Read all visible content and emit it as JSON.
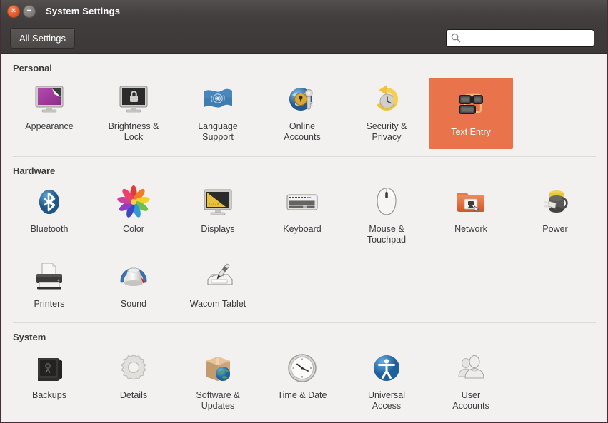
{
  "window": {
    "title": "System Settings",
    "close_label": "×",
    "minimize_label": "−"
  },
  "toolbar": {
    "all_settings_label": "All Settings",
    "search_placeholder": "",
    "search_value": "",
    "search_icon": "search-icon"
  },
  "colors": {
    "selection": "#e9744c",
    "titlebar": "#464342",
    "content_bg": "#f2f1f0",
    "label_text": "#3b3b3b",
    "section_text": "#3c3b37"
  },
  "sections": [
    {
      "title": "Personal",
      "rows": [
        [
          {
            "label": "Appearance",
            "icon": "appearance-icon",
            "selected": false
          },
          {
            "label": "Brightness &\nLock",
            "icon": "brightness-lock-icon",
            "selected": false
          },
          {
            "label": "Language\nSupport",
            "icon": "language-support-icon",
            "selected": false
          },
          {
            "label": "Online\nAccounts",
            "icon": "online-accounts-icon",
            "selected": false
          },
          {
            "label": "Security &\nPrivacy",
            "icon": "security-privacy-icon",
            "selected": false
          },
          {
            "label": "Text Entry",
            "icon": "text-entry-icon",
            "selected": true
          }
        ]
      ]
    },
    {
      "title": "Hardware",
      "rows": [
        [
          {
            "label": "Bluetooth",
            "icon": "bluetooth-icon",
            "selected": false
          },
          {
            "label": "Color",
            "icon": "color-icon",
            "selected": false
          },
          {
            "label": "Displays",
            "icon": "displays-icon",
            "selected": false
          },
          {
            "label": "Keyboard",
            "icon": "keyboard-icon",
            "selected": false
          },
          {
            "label": "Mouse &\nTouchpad",
            "icon": "mouse-touchpad-icon",
            "selected": false
          },
          {
            "label": "Network",
            "icon": "network-icon",
            "selected": false
          },
          {
            "label": "Power",
            "icon": "power-icon",
            "selected": false
          }
        ],
        [
          {
            "label": "Printers",
            "icon": "printers-icon",
            "selected": false
          },
          {
            "label": "Sound",
            "icon": "sound-icon",
            "selected": false
          },
          {
            "label": "Wacom Tablet",
            "icon": "wacom-tablet-icon",
            "selected": false
          }
        ]
      ]
    },
    {
      "title": "System",
      "rows": [
        [
          {
            "label": "Backups",
            "icon": "backups-icon",
            "selected": false
          },
          {
            "label": "Details",
            "icon": "details-icon",
            "selected": false
          },
          {
            "label": "Software &\nUpdates",
            "icon": "software-updates-icon",
            "selected": false
          },
          {
            "label": "Time & Date",
            "icon": "time-date-icon",
            "selected": false
          },
          {
            "label": "Universal\nAccess",
            "icon": "universal-access-icon",
            "selected": false
          },
          {
            "label": "User\nAccounts",
            "icon": "user-accounts-icon",
            "selected": false
          }
        ]
      ]
    }
  ]
}
